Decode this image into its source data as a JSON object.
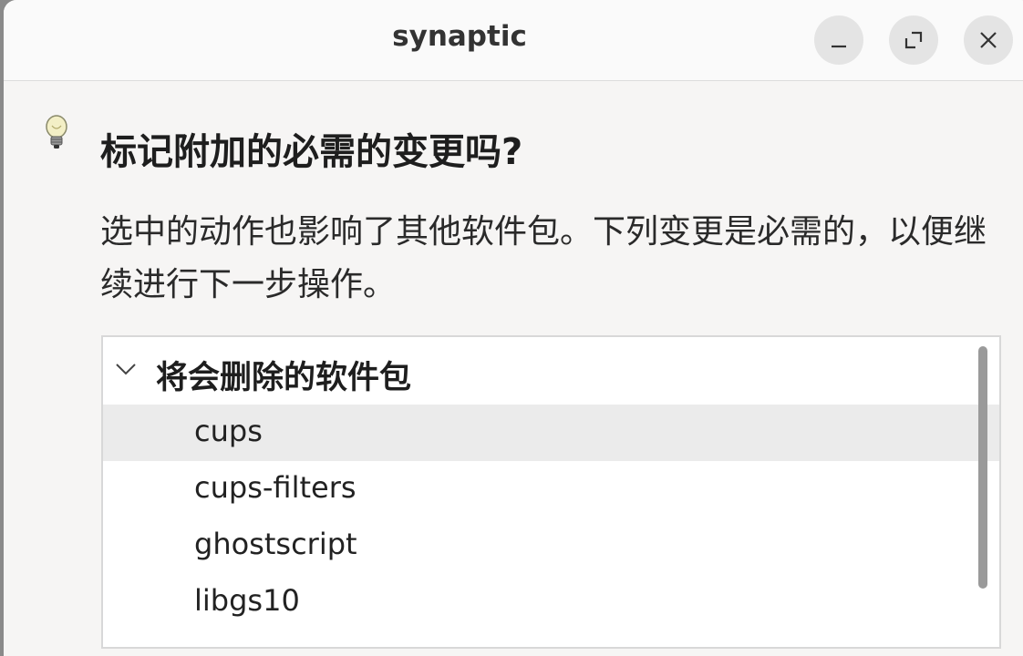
{
  "window": {
    "title": "synaptic",
    "buttons": [
      "minimize-icon",
      "maximize-icon",
      "close-icon"
    ]
  },
  "dialog": {
    "icon": "lightbulb-icon",
    "heading": "标记附加的必需的变更吗?",
    "message": "选中的动作也影响了其他软件包。下列变更是必需的，以便继续进行下一步操作。"
  },
  "tree": {
    "group_label": "将会删除的软件包",
    "expander_icon": "chevron-down-icon",
    "packages": [
      "cups",
      "cups-filters",
      "ghostscript",
      "libgs10"
    ]
  }
}
